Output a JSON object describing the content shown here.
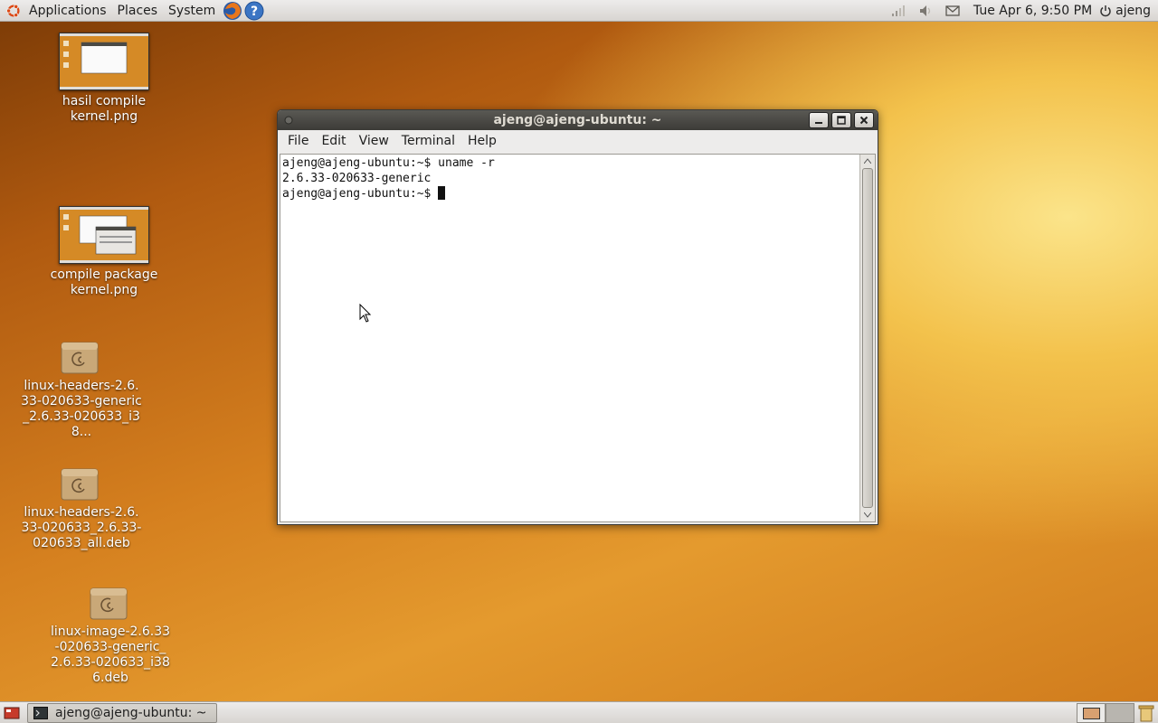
{
  "top_panel": {
    "menus": [
      "Applications",
      "Places",
      "System"
    ],
    "clock": "Tue Apr  6,  9:50 PM",
    "user": "ajeng"
  },
  "desktop": {
    "icons": [
      {
        "label": "hasil compile kernel.png"
      },
      {
        "label": "compile package kernel.png"
      },
      {
        "label": "linux-headers-2.6.33-020633-generic_2.6.33-020633_i38..."
      },
      {
        "label": "linux-headers-2.6.33-020633_2.6.33-020633_all.deb"
      },
      {
        "label": "linux-image-2.6.33-020633-generic_2.6.33-020633_i386.deb"
      }
    ]
  },
  "terminal": {
    "title": "ajeng@ajeng-ubuntu: ~",
    "menus": [
      "File",
      "Edit",
      "View",
      "Terminal",
      "Help"
    ],
    "lines": [
      "ajeng@ajeng-ubuntu:~$ uname -r",
      "2.6.33-020633-generic",
      "ajeng@ajeng-ubuntu:~$ "
    ]
  },
  "bottom_panel": {
    "task_label": "ajeng@ajeng-ubuntu: ~"
  },
  "colors": {
    "panel": "#edeceb",
    "titlebar": "#3c3b37",
    "desktop_orange": "#d5801f"
  }
}
